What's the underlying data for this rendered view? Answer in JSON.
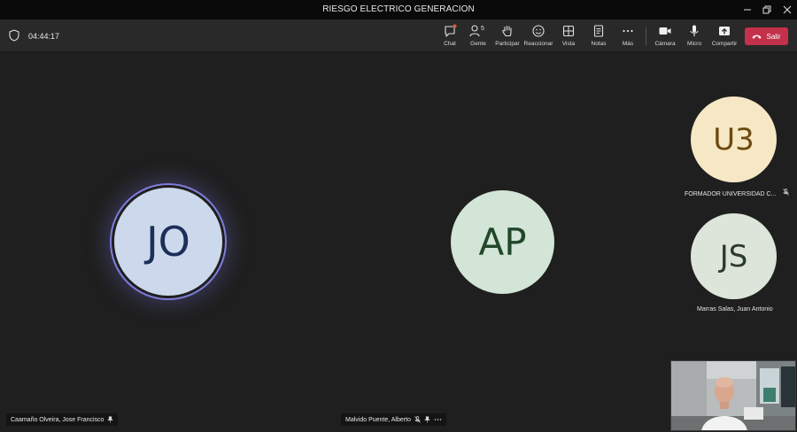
{
  "window": {
    "title": "RIESGO ELECTRICO GENERACION"
  },
  "meeting": {
    "elapsed": "04:44:17"
  },
  "toolbar": {
    "chat": "Chat",
    "people": "Gente",
    "people_count": "5",
    "raise_hand": "Participar",
    "react": "Reaccionar",
    "view": "Vista",
    "notes": "Notas",
    "more": "Más",
    "camera": "Cámara",
    "mic": "Micro",
    "share": "Compartir",
    "leave": "Salir"
  },
  "participants": {
    "main_left": {
      "initials": "JO",
      "name": "Caamaño Olveira, Jose Francisco"
    },
    "main_right": {
      "initials": "AP",
      "name": "Malvido Puente, Alberto"
    },
    "side_top": {
      "initials": "U3",
      "name": "FORMADOR UNIVERSIDAD C..."
    },
    "side_bottom": {
      "initials": "JS",
      "name": "Marras Salas, Juan Antonio"
    }
  },
  "colors": {
    "leave_button": "#c4314b",
    "speaking_ring": "#7f7ddb",
    "chat_badge": "#e05a3a"
  }
}
